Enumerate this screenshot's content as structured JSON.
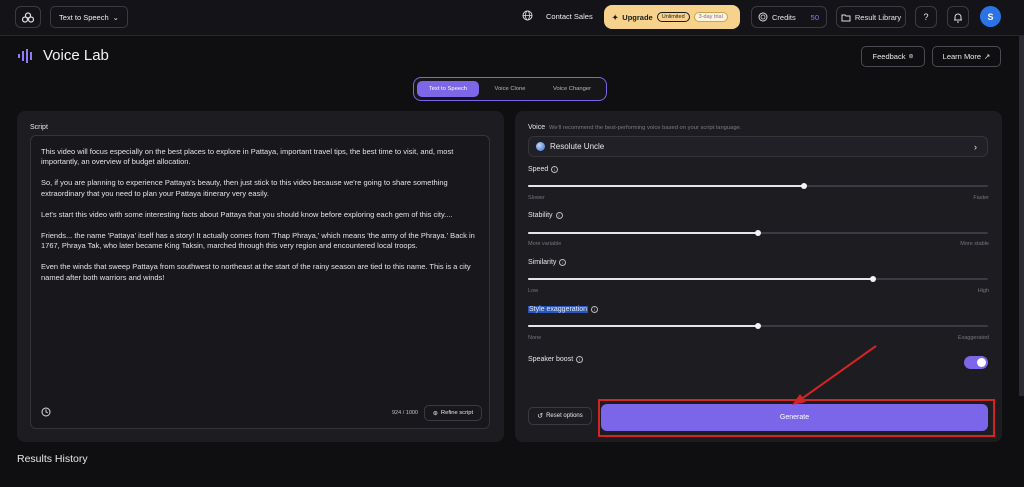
{
  "topbar": {
    "mode_select": "Text to Speech",
    "contact": "Contact Sales",
    "upgrade": "Upgrade",
    "unlimited": "Unlimited",
    "trial": "3-day trial",
    "credits_label": "Credits",
    "credits_value": "50",
    "library": "Result Library",
    "help": "?",
    "avatar": "S"
  },
  "header": {
    "title": "Voice Lab",
    "feedback": "Feedback",
    "learn_more": "Learn More"
  },
  "tabs": [
    "Text to Speech",
    "Voice Clone",
    "Voice Changer"
  ],
  "script": {
    "label": "Script",
    "paragraphs": [
      "This video will focus especially on the best places to explore in Pattaya, important travel tips, the best time to visit, and, most importantly, an overview of budget allocation.",
      "So, if you are planning to experience Pattaya's beauty, then just stick to this video because we're going to share something extraordinary that you need to plan your Pattaya itinerary very easily.",
      "Let's start this video with some interesting facts about Pattaya that you should know before exploring each gem of this city....",
      "Friends... the name 'Pattaya' itself has a story! It actually comes from 'Thap Phraya,' which means 'the army of the Phraya.' Back in 1767, Phraya Tak, who later became King Taksin, marched through this very region and encountered local troops.",
      "Even the winds that sweep Pattaya from southwest to northeast at the start of the rainy season are tied to this name. This is a city named after both warriors and winds!"
    ],
    "counter": "924 / 1000",
    "refine": "Refine script"
  },
  "voice": {
    "label": "Voice",
    "hint": "We'll recommend the best-performing voice based on your script language.",
    "selected": "Resolute Uncle"
  },
  "settings": {
    "speed": {
      "label": "Speed",
      "min": "Slower",
      "max": "Faster",
      "value": 0.6
    },
    "stability": {
      "label": "Stability",
      "min": "More variable",
      "max": "More stable",
      "value": 0.5
    },
    "similarity": {
      "label": "Similarity",
      "min": "Low",
      "max": "High",
      "value": 0.75
    },
    "style": {
      "label": "Style exaggeration",
      "min": "None",
      "max": "Exaggerated",
      "value": 0.5
    },
    "speaker_boost": {
      "label": "Speaker boost",
      "enabled": true
    }
  },
  "actions": {
    "reset": "Reset options",
    "generate": "Generate"
  },
  "results_history": "Results History",
  "colors": {
    "accent": "#7b66ea",
    "upgrade": "#f6d28d",
    "annotation": "#d42525"
  }
}
